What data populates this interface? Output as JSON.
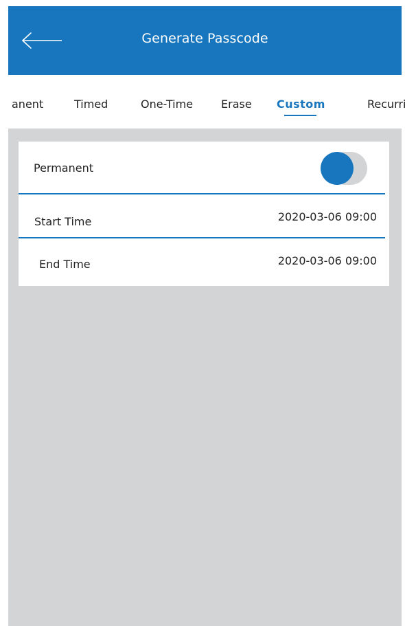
{
  "header": {
    "title": "Generate Passcode",
    "back_icon": "arrow-left-icon",
    "background_color": "#1776bd"
  },
  "tabs": [
    {
      "label": "anent",
      "active": false
    },
    {
      "label": "Timed",
      "active": false
    },
    {
      "label": "One-Time",
      "active": false
    },
    {
      "label": "Erase",
      "active": false
    },
    {
      "label": "Custom",
      "active": true
    },
    {
      "label": "Recurri",
      "active": false
    }
  ],
  "form": {
    "permanent": {
      "label": "Permanent",
      "toggle_on": false
    },
    "start_time": {
      "label": "Start Time",
      "value": "2020-03-06 09:00"
    },
    "end_time": {
      "label": "End Time",
      "value": "2020-03-06 09:00"
    }
  },
  "colors": {
    "accent": "#1776bd",
    "content_background": "#d3d4d6",
    "text": "#222222"
  }
}
